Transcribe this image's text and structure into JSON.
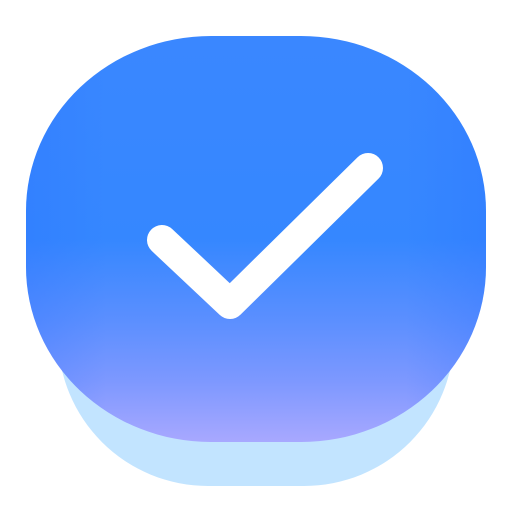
{
  "icon": {
    "name": "checkmark-icon",
    "colors": {
      "button_top": "#3587ff",
      "button_bottom": "#a8a8ff",
      "shadow": "#c2e4ff",
      "check": "#ffffff",
      "background": "#ffffff"
    }
  }
}
